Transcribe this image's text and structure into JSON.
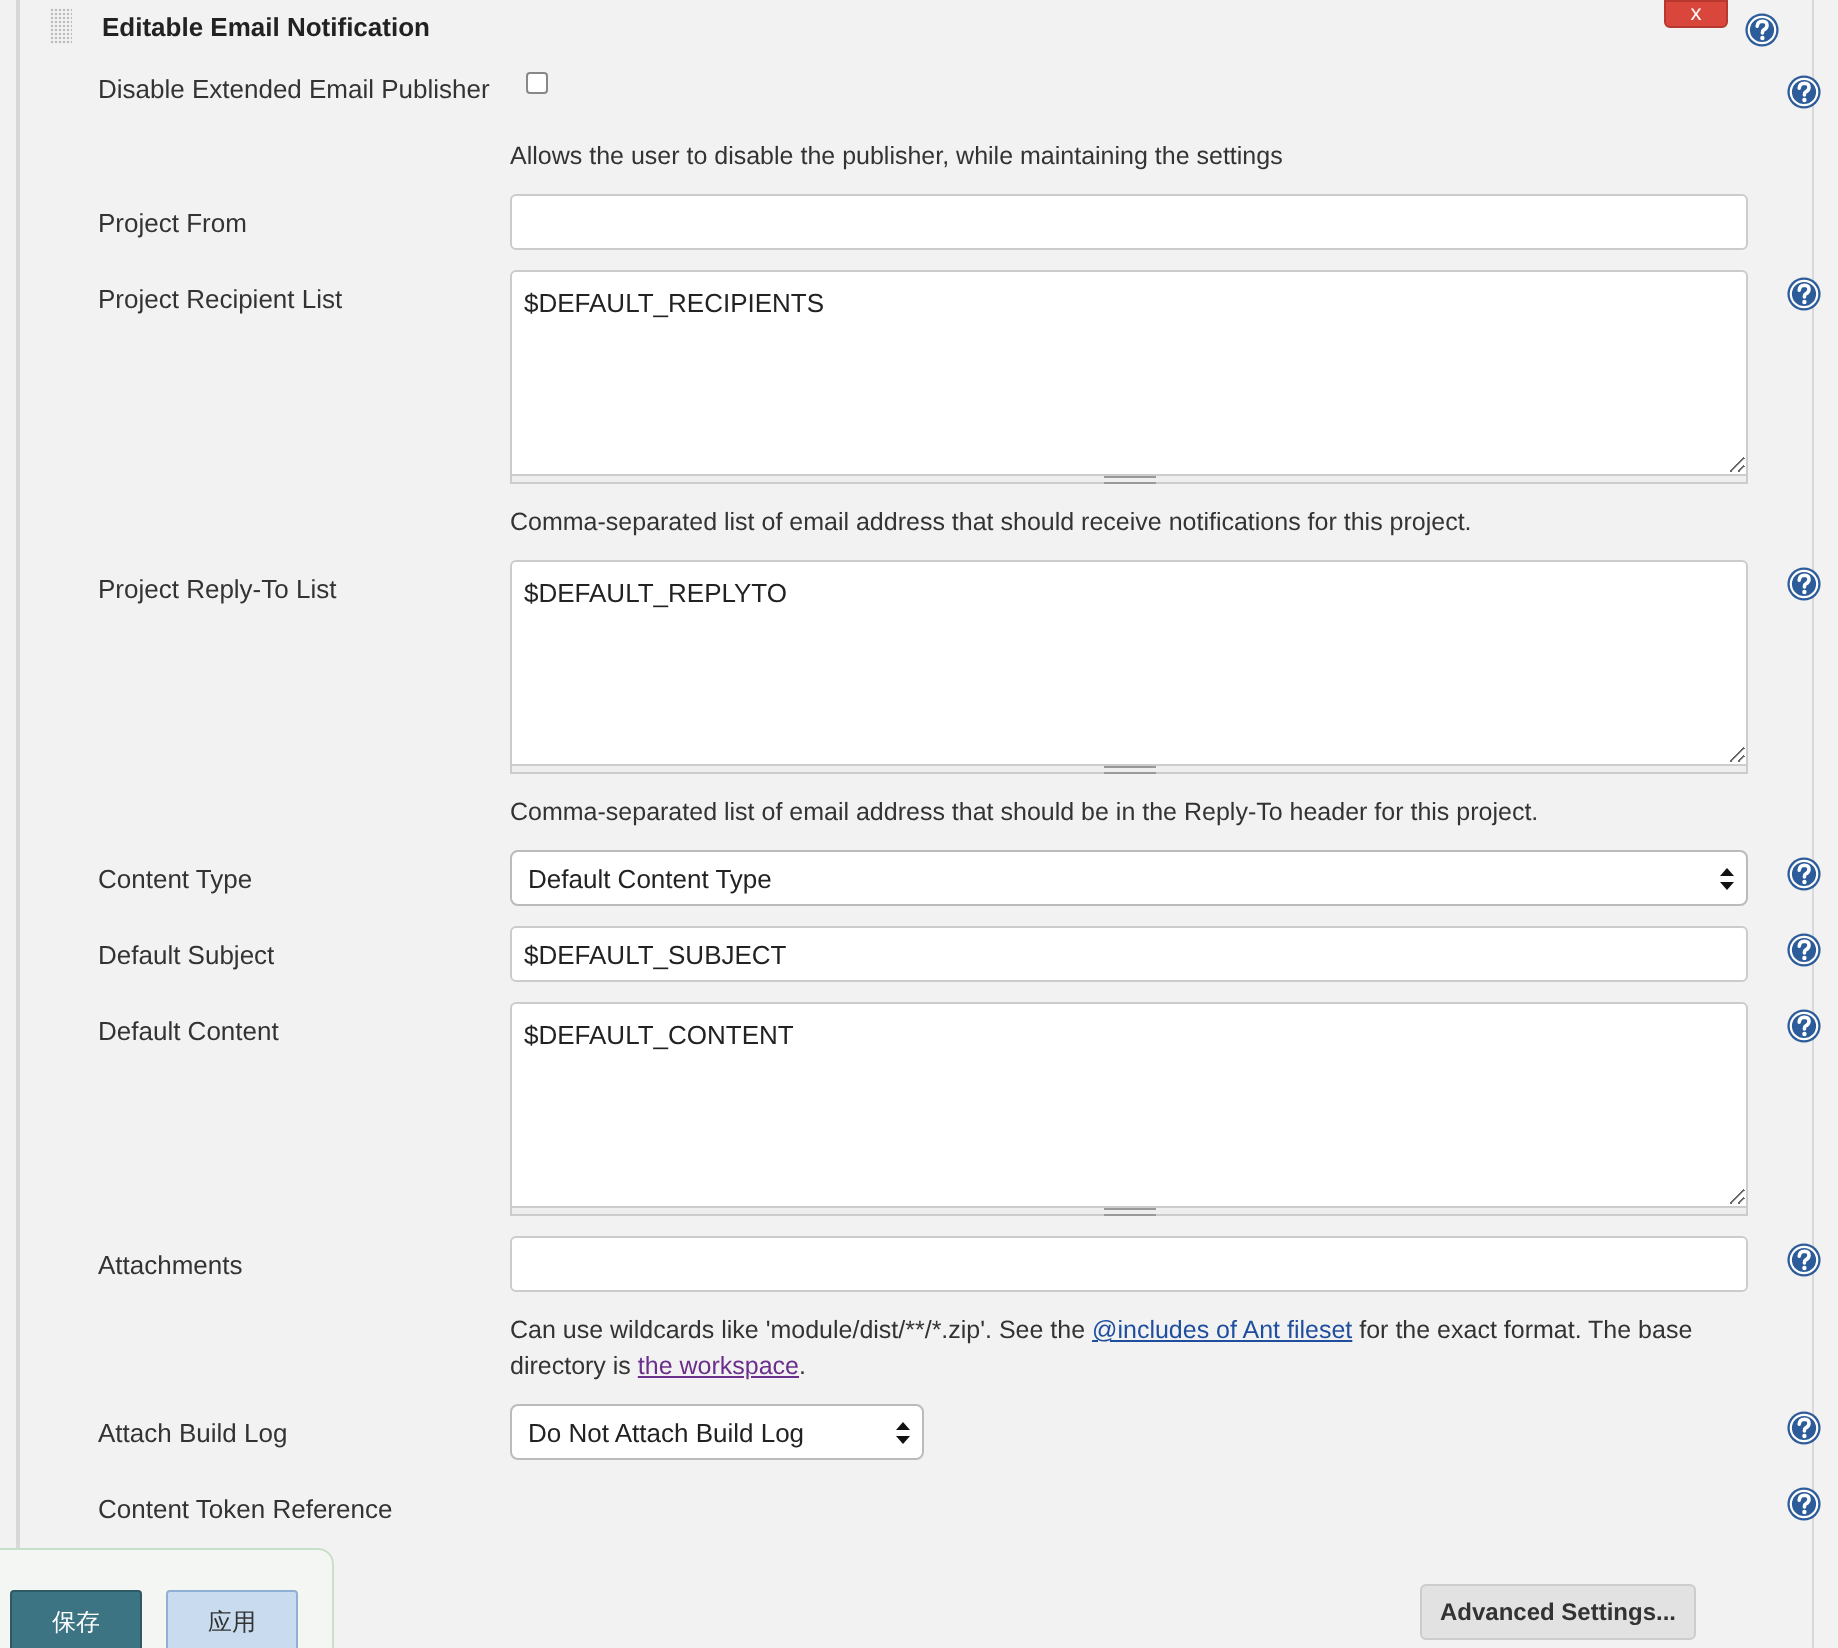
{
  "section": {
    "title": "Editable Email Notification",
    "delete_label": "x",
    "help": true
  },
  "fields": [
    {
      "kind": "checkbox",
      "label": "Disable Extended Email Publisher",
      "checked": false,
      "help": true,
      "description": [
        {
          "kind": "text",
          "text": "Allows the user to disable the publisher, while maintaining the settings"
        }
      ]
    },
    {
      "kind": "text",
      "label": "Project From",
      "help": false
    },
    {
      "kind": "textarea",
      "label": "Project Recipient List",
      "value": "$DEFAULT_RECIPIENTS",
      "help": true,
      "description": [
        {
          "kind": "text",
          "text": "Comma-separated list of email address that should receive notifications for this project."
        }
      ]
    },
    {
      "kind": "textarea",
      "label": "Project Reply-To List",
      "value": "$DEFAULT_REPLYTO",
      "help": true,
      "description": [
        {
          "kind": "text",
          "text": "Comma-separated list of email address that should be in the Reply-To header for this project."
        }
      ]
    },
    {
      "kind": "select",
      "label": "Content Type",
      "value": "Default Content Type",
      "help": true
    },
    {
      "kind": "text",
      "label": "Default Subject",
      "value": "$DEFAULT_SUBJECT",
      "help": true
    },
    {
      "kind": "textarea",
      "label": "Default Content",
      "value": "$DEFAULT_CONTENT",
      "help": true
    },
    {
      "kind": "text",
      "label": "Attachments",
      "help": true,
      "description": [
        {
          "kind": "text",
          "text": "Can use wildcards like 'module/dist/**/*.zip'. See the "
        },
        {
          "kind": "link",
          "text": "@includes of Ant fileset",
          "visited": false
        },
        {
          "kind": "text",
          "text": " for the exact format. The base directory is "
        },
        {
          "kind": "link",
          "text": "the workspace",
          "visited": true
        },
        {
          "kind": "text",
          "text": "."
        }
      ]
    },
    {
      "kind": "select",
      "label": "Attach Build Log",
      "value": "Do Not Attach Build Log",
      "help": true,
      "narrow": true
    },
    {
      "kind": "label",
      "label": "Content Token Reference",
      "help": true
    }
  ],
  "advanced_button": "Advanced Settings...",
  "bottom_bar": {
    "buttons": [
      {
        "label": "保存",
        "primary": true
      },
      {
        "label": "应用",
        "primary": false
      }
    ]
  }
}
